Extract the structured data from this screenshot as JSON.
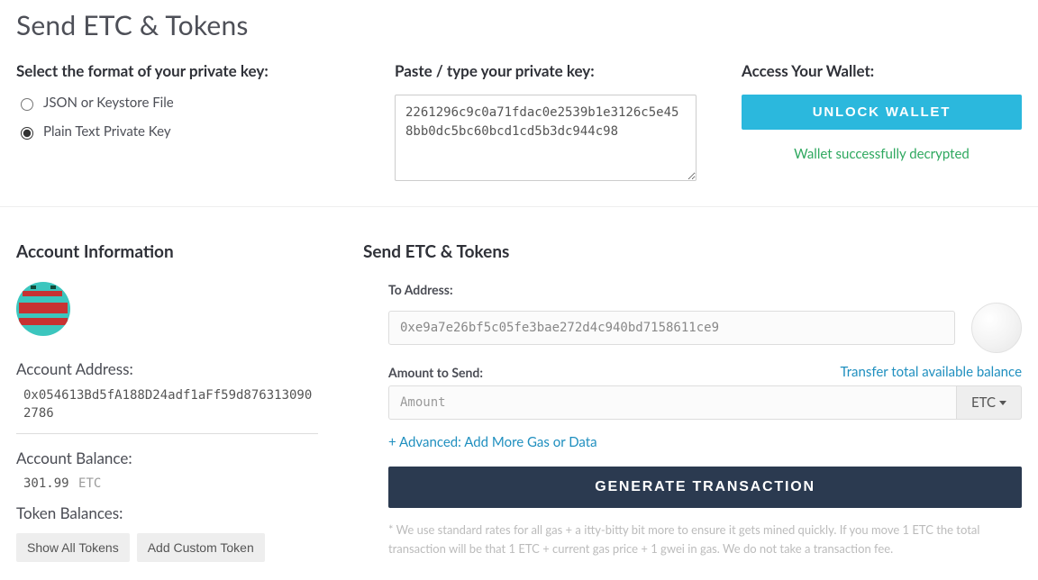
{
  "page_title": "Send ETC & Tokens",
  "format": {
    "label": "Select the format of your private key:",
    "options": [
      {
        "label": "JSON or Keystore File",
        "checked": false
      },
      {
        "label": "Plain Text Private Key",
        "checked": true
      }
    ]
  },
  "paste": {
    "label": "Paste / type your private key:",
    "value": "2261296c9c0a71fdac0e2539b1e3126c5e458bb0dc5bc60bcd1cd5b3dc944c98"
  },
  "access": {
    "label": "Access Your Wallet:",
    "button": "UNLOCK WALLET",
    "success_msg": "Wallet successfully decrypted"
  },
  "account": {
    "heading": "Account Information",
    "address_label": "Account Address:",
    "address": "0x054613Bd5fA188D24adf1aFf59d8763130902786",
    "balance_label": "Account Balance:",
    "balance_value": "301.99",
    "balance_symbol": "ETC",
    "tokens_label": "Token Balances:",
    "show_all": "Show All Tokens",
    "add_custom": "Add Custom Token"
  },
  "send": {
    "heading": "Send ETC & Tokens",
    "to_label": "To Address:",
    "to_value": "0xe9a7e26bf5c05fe3bae272d4c940bd7158611ce9",
    "amount_label": "Amount to Send:",
    "transfer_all": "Transfer total available balance",
    "amount_placeholder": "Amount",
    "currency": "ETC",
    "advanced": "+ Advanced: Add More Gas or Data",
    "generate": "GENERATE TRANSACTION",
    "footnote": "* We use standard rates for all gas + a itty-bitty bit more to ensure it gets mined quickly. If you move 1 ETC the total transaction will be that 1 ETC + current gas price + 1 gwei in gas. We do not take a transaction fee."
  }
}
